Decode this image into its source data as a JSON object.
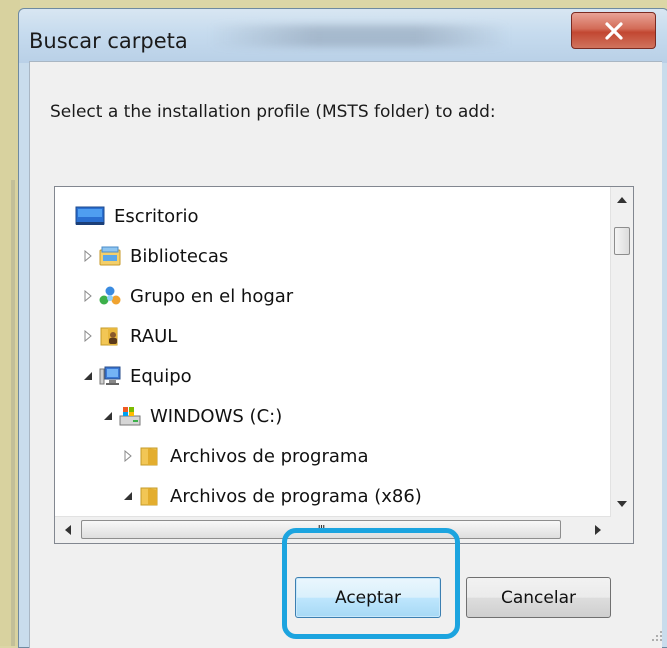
{
  "dialog": {
    "title": "Buscar carpeta",
    "prompt": "Select a the installation profile (MSTS folder) to add:"
  },
  "tree": {
    "items": [
      {
        "label": "Escritorio",
        "icon": "desktop-icon",
        "expander": "none"
      },
      {
        "label": "Bibliotecas",
        "icon": "libraries-icon",
        "expander": "collapsed"
      },
      {
        "label": "Grupo en el hogar",
        "icon": "homegroup-icon",
        "expander": "collapsed"
      },
      {
        "label": "RAUL",
        "icon": "user-folder-icon",
        "expander": "collapsed"
      },
      {
        "label": "Equipo",
        "icon": "computer-icon",
        "expander": "expanded"
      },
      {
        "label": "WINDOWS (C:)",
        "icon": "drive-icon",
        "expander": "expanded"
      },
      {
        "label": "Archivos de programa",
        "icon": "folder-icon",
        "expander": "collapsed"
      },
      {
        "label": "Archivos de programa (x86)",
        "icon": "folder-icon",
        "expander": "expanded"
      }
    ],
    "hscroll_grip": "III"
  },
  "buttons": {
    "ok_label": "Aceptar",
    "cancel_label": "Cancelar"
  },
  "colors": {
    "highlight": "#1ca4df",
    "close_button": "#c24732",
    "background": "#dcd6a6"
  }
}
